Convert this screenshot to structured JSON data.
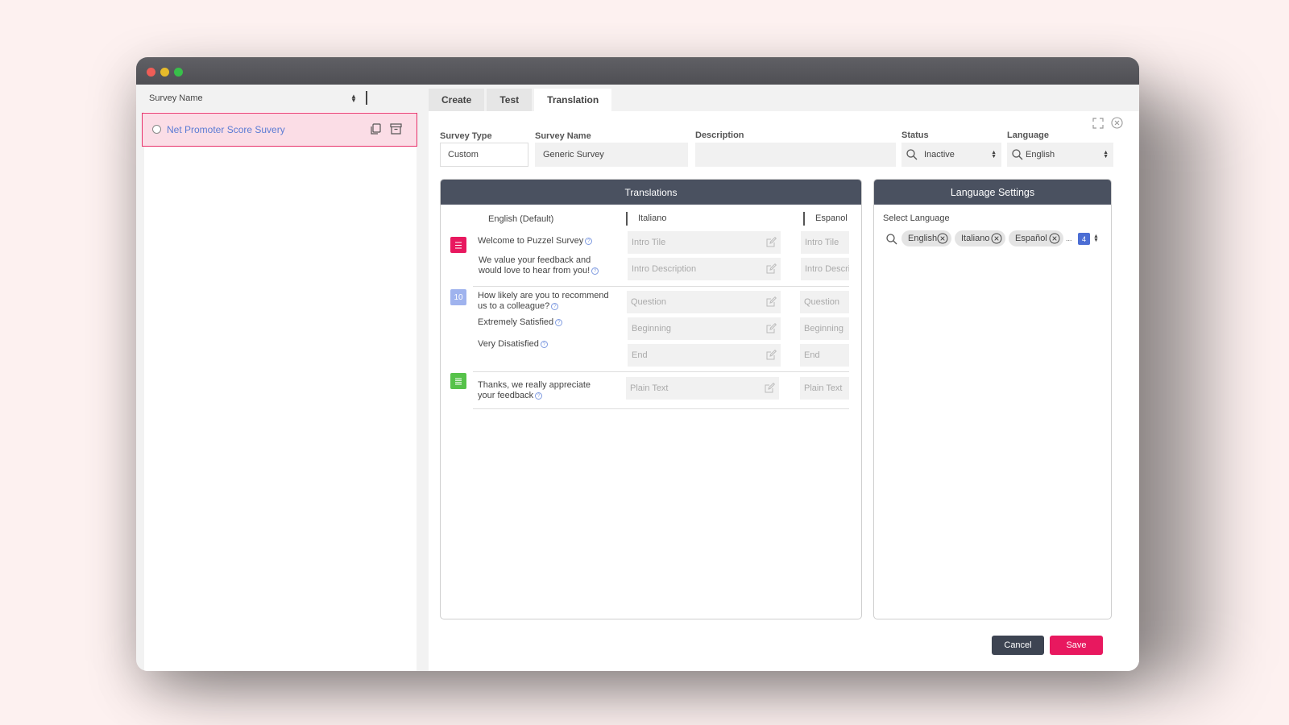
{
  "sidebar": {
    "sort_label": "Survey Name",
    "items": [
      {
        "name": "Net Promoter Score Suvery"
      }
    ]
  },
  "tabs": [
    {
      "label": "Create"
    },
    {
      "label": "Test"
    },
    {
      "label": "Translation",
      "active": true
    }
  ],
  "form": {
    "survey_type_label": "Survey Type",
    "survey_type_value": "Custom",
    "survey_name_label": "Survey Name",
    "survey_name_value": "Generic Survey",
    "description_label": "Description",
    "description_value": "",
    "status_label": "Status",
    "status_value": "Inactive",
    "language_label": "Language",
    "language_value": "English"
  },
  "translations": {
    "title": "Translations",
    "columns": [
      "English (Default)",
      "Italiano",
      "Espanol"
    ],
    "rows": [
      {
        "icon": "list-icon",
        "icon_color": "#e8185f",
        "texts": [
          "Welcome to Puzzel Survey",
          "We value your feedback and would love to hear from you!"
        ],
        "italiano": [
          "Intro Tile",
          "Intro Description"
        ],
        "espanol": [
          "Intro Tile",
          "Intro Description"
        ]
      },
      {
        "icon": "nps-icon",
        "icon_label": "10",
        "icon_color": "#9fb3ee",
        "texts": [
          "How likely are you to recommend us to a colleague?",
          "Extremely Satisfied",
          "Very Disatisfied"
        ],
        "italiano": [
          "Question",
          "Beginning",
          "End"
        ],
        "espanol": [
          "Question",
          "Beginning",
          "End"
        ]
      },
      {
        "icon": "text-icon",
        "icon_color": "#56c24a",
        "texts": [
          "Thanks, we really appreciate your feedback"
        ],
        "italiano": [
          "Plain Text"
        ],
        "espanol": [
          "Plain Text"
        ]
      }
    ]
  },
  "language_settings": {
    "title": "Language Settings",
    "select_label": "Select Language",
    "chips": [
      "English",
      "Italiano",
      "Español"
    ],
    "overflow": "...",
    "count": "4"
  },
  "actions": {
    "cancel_label": "Cancel",
    "save_label": "Save"
  },
  "colors": {
    "accent": "#e8185f",
    "header": "#4a5160",
    "link": "#5b7bd4"
  }
}
